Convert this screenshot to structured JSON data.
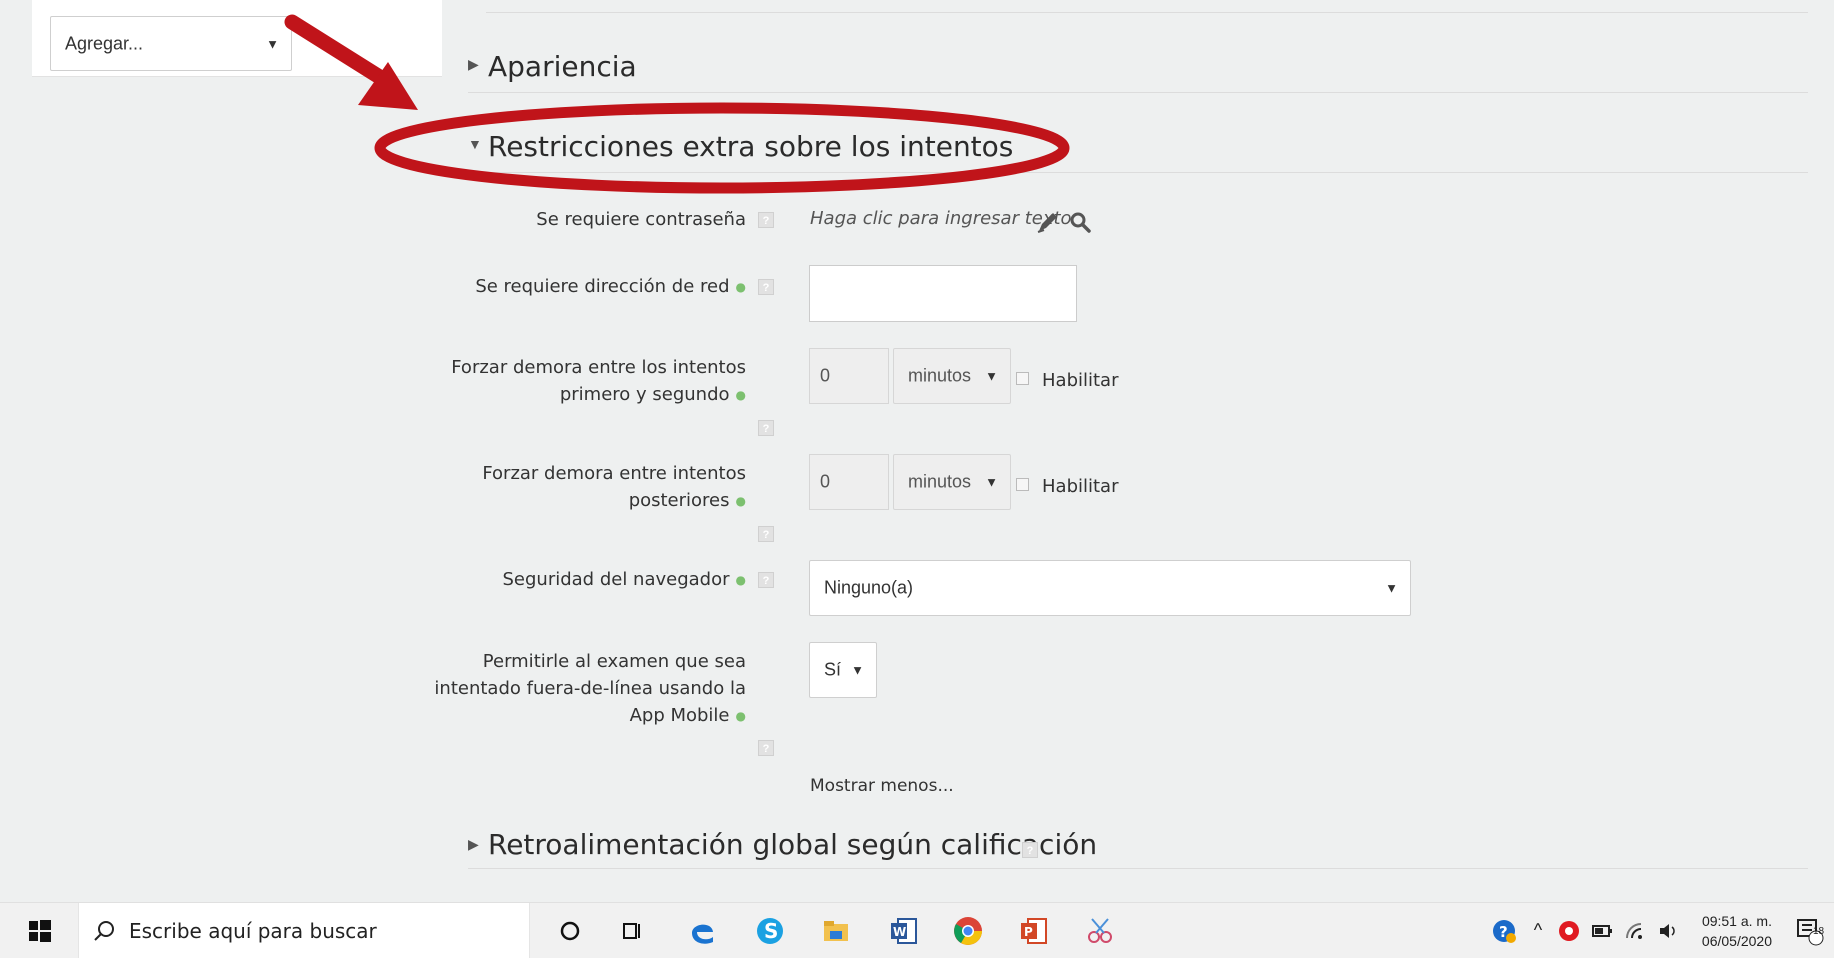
{
  "sidebar": {
    "add_select": "Agregar..."
  },
  "sections": {
    "apariencia": "Apariencia",
    "restricciones": "Restricciones extra sobre los intentos",
    "retroalimentacion": "Retroalimentación global según calificación"
  },
  "form": {
    "password": {
      "label": "Se requiere contraseña",
      "hint": "Haga clic para ingresar texto"
    },
    "network": {
      "label": "Se requiere dirección de red",
      "value": ""
    },
    "delay1": {
      "label_line1": "Forzar demora entre los intentos",
      "label_line2": "primero y segundo",
      "value": "0",
      "unit": "minutos",
      "enable": "Habilitar"
    },
    "delay2": {
      "label_line1": "Forzar demora entre intentos",
      "label_line2": "posteriores",
      "value": "0",
      "unit": "minutos",
      "enable": "Habilitar"
    },
    "browser": {
      "label": "Seguridad del navegador",
      "value": "Ninguno(a)"
    },
    "offline": {
      "label_line1": "Permitirle al examen que sea",
      "label_line2": "intentado fuera-de-línea usando la",
      "label_line3": "App Mobile",
      "value": "Sí"
    },
    "show_less": "Mostrar menos..."
  },
  "taskbar": {
    "search_placeholder": "Escribe aquí para buscar",
    "time": "09:51 a. m.",
    "date": "06/05/2020",
    "notification_count": "18"
  },
  "colors": {
    "annotation_red": "#c0141a",
    "required_green": "#7cc06f"
  }
}
